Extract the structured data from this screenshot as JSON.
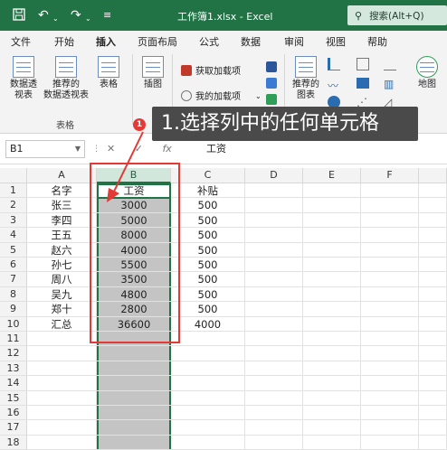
{
  "titlebar": {
    "doc_title": "工作簿1.xlsx  -  Excel",
    "search_placeholder": "搜索(Alt+Q)",
    "save_icon": "save-icon",
    "undo_icon": "undo-icon",
    "redo_icon": "redo-icon"
  },
  "menu": {
    "tabs": [
      "文件",
      "开始",
      "插入",
      "页面布局",
      "公式",
      "数据",
      "审阅",
      "视图",
      "帮助"
    ],
    "active": "插入"
  },
  "ribbon": {
    "pivot_table": "数据透\n视表",
    "recommended_pivot": "推荐的\n数据透视表",
    "table": "表格",
    "group_table": "表格",
    "illustrations": "插图",
    "get_addins": "获取加载项",
    "my_addins": "我的加载项",
    "recommended_charts": "推荐的\n图表",
    "map": "地图"
  },
  "formula_bar": {
    "cell_ref": "B1",
    "fx_label": "fx",
    "value": "工资"
  },
  "grid": {
    "columns": [
      "A",
      "B",
      "C",
      "D",
      "E",
      "F"
    ],
    "selected_column": "B",
    "rows": [
      {
        "num": "1",
        "A": "名字",
        "B": "工资",
        "C": "补贴"
      },
      {
        "num": "2",
        "A": "张三",
        "B": "3000",
        "C": "500"
      },
      {
        "num": "3",
        "A": "李四",
        "B": "5000",
        "C": "500"
      },
      {
        "num": "4",
        "A": "王五",
        "B": "8000",
        "C": "500"
      },
      {
        "num": "5",
        "A": "赵六",
        "B": "4000",
        "C": "500"
      },
      {
        "num": "6",
        "A": "孙七",
        "B": "5500",
        "C": "500"
      },
      {
        "num": "7",
        "A": "周八",
        "B": "3500",
        "C": "500"
      },
      {
        "num": "8",
        "A": "吴九",
        "B": "4800",
        "C": "500"
      },
      {
        "num": "9",
        "A": "郑十",
        "B": "2800",
        "C": "500"
      },
      {
        "num": "10",
        "A": "汇总",
        "B": "36600",
        "C": "4000"
      },
      {
        "num": "11",
        "A": "",
        "B": "",
        "C": ""
      },
      {
        "num": "12",
        "A": "",
        "B": "",
        "C": ""
      },
      {
        "num": "13",
        "A": "",
        "B": "",
        "C": ""
      },
      {
        "num": "14",
        "A": "",
        "B": "",
        "C": ""
      },
      {
        "num": "15",
        "A": "",
        "B": "",
        "C": ""
      },
      {
        "num": "16",
        "A": "",
        "B": "",
        "C": ""
      },
      {
        "num": "17",
        "A": "",
        "B": "",
        "C": ""
      },
      {
        "num": "18",
        "A": "",
        "B": "",
        "C": ""
      }
    ]
  },
  "annotation": {
    "badge": "1",
    "text": "1.选择列中的任何单元格",
    "accent": "#e53935"
  },
  "colors": {
    "excel_green": "#217346",
    "selection_gray": "#c4c4c4"
  }
}
